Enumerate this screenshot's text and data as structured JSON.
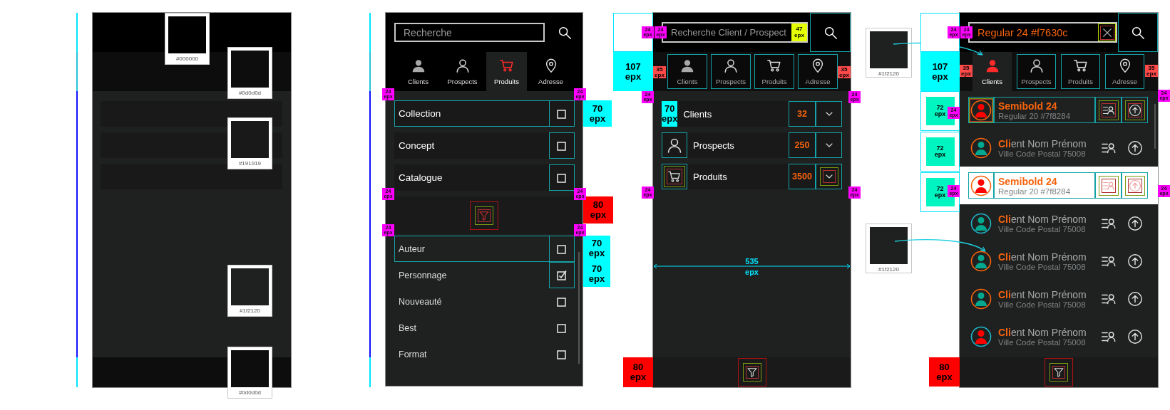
{
  "palette_panel": {
    "swatches": [
      {
        "label": "#000000",
        "color": "#000000"
      },
      {
        "label": "#0d0d0d",
        "color": "#0d0d0d"
      },
      {
        "label": "#191919",
        "color": "#191919"
      },
      {
        "label": "#1f2120",
        "color": "#1f2120"
      },
      {
        "label": "#0d0d0d",
        "color": "#0d0d0d"
      }
    ]
  },
  "filter_panel": {
    "search": {
      "placeholder": "Recherche"
    },
    "tabs": [
      {
        "label": "Clients",
        "selected": false
      },
      {
        "label": "Prospects",
        "selected": false
      },
      {
        "label": "Produits",
        "selected": true
      },
      {
        "label": "Adresse",
        "selected": false
      }
    ],
    "categories": [
      {
        "label": "Collection",
        "checked": false
      },
      {
        "label": "Concept",
        "checked": false
      },
      {
        "label": "Catalogue",
        "checked": false
      }
    ],
    "options": [
      {
        "label": "Auteur",
        "checked": false
      },
      {
        "label": "Personnage",
        "checked": true
      },
      {
        "label": "Nouveauté",
        "checked": false
      },
      {
        "label": "Best",
        "checked": false
      },
      {
        "label": "Format",
        "checked": false
      }
    ]
  },
  "summary_panel": {
    "search": {
      "placeholder": "Recherche Client / Prospect"
    },
    "tabs": [
      {
        "label": "Clients",
        "selected": false
      },
      {
        "label": "Prospects",
        "selected": false
      },
      {
        "label": "Produits",
        "selected": false
      },
      {
        "label": "Adresse",
        "selected": false
      }
    ],
    "rows": [
      {
        "label": "Clients",
        "count": "32",
        "icon_note": "70 epx"
      },
      {
        "label": "Prospects",
        "count": "250"
      },
      {
        "label": "Produits",
        "count": "3500"
      }
    ],
    "width_note": "535 epx"
  },
  "list_panel": {
    "search": {
      "value": "Regular 24 #f7630c"
    },
    "tabs": [
      {
        "label": "Clients",
        "selected": true
      },
      {
        "label": "Prospects",
        "selected": false
      },
      {
        "label": "Produits",
        "selected": false
      },
      {
        "label": "Adresse",
        "selected": false
      }
    ],
    "rows": [
      {
        "kind": "spec",
        "name": "Semibold 24",
        "subtitle": "Regular 20 #7f8284",
        "avatar": {
          "color": "#ff0000"
        },
        "ring": {
          "color": "#f7630c"
        },
        "selected": false
      },
      {
        "kind": "client",
        "name": "**Cli**ent Nom Prénom",
        "subtitle": "Ville Code Postal 75008",
        "avatar": {
          "color": "#00a88f"
        },
        "ring": {
          "color": "#f7630c"
        },
        "selected": false
      },
      {
        "kind": "spec",
        "name": "Semibold 24",
        "subtitle": "Regular 20 #7f8284",
        "avatar": {
          "color": "#ff0000"
        },
        "ring": {
          "color": "#f7630c"
        },
        "selected": true
      },
      {
        "kind": "client",
        "name": "**Cli**ent Nom Prénom",
        "subtitle": "Ville Code Postal 75008",
        "avatar": {
          "color": "#00a88f"
        },
        "ring": {
          "color": "#1fb5c9"
        },
        "selected": false
      },
      {
        "kind": "client",
        "name": "**Cli**ent Nom Prénom",
        "subtitle": "Ville Code Postal 75008",
        "avatar": {
          "color": "#00a88f"
        },
        "ring": {
          "color": "#f7630c"
        },
        "selected": false
      },
      {
        "kind": "client",
        "name": "**Cli**ent Nom Prénom",
        "subtitle": "Ville Code Postal 75008",
        "avatar": {
          "color": "#00a88f"
        },
        "ring": {
          "color": "#f7630c"
        },
        "selected": false
      },
      {
        "kind": "client",
        "name": "**Cli**ent Nom Prénom",
        "subtitle": "Ville Code Postal 75008",
        "avatar": {
          "color": "#ff0000"
        },
        "ring": {
          "color": "#1fb5c9"
        },
        "selected": false
      }
    ]
  },
  "callouts": [
    {
      "label": "#1f2120",
      "color": "#1f2120"
    },
    {
      "label": "#1f2120",
      "color": "#1f2120"
    }
  ],
  "annotations": [
    {
      "text": "70 epx",
      "kind": "cyan"
    },
    {
      "text": "80 epx",
      "kind": "red"
    },
    {
      "text": "70 epx",
      "kind": "cyan"
    },
    {
      "text": "70 epx",
      "kind": "cyan"
    },
    {
      "text": "107 epx",
      "kind": "cyan"
    },
    {
      "text": "47 epx",
      "kind": "yellow"
    },
    {
      "text": "35 epx",
      "kind": "small-red"
    },
    {
      "text": "35 epx",
      "kind": "small-red"
    },
    {
      "text": "80 epx",
      "kind": "red"
    },
    {
      "text": "107 epx",
      "kind": "cyan"
    },
    {
      "text": "72 epx",
      "kind": "green"
    },
    {
      "text": "72 epx",
      "kind": "green"
    },
    {
      "text": "72 epx",
      "kind": "green"
    },
    {
      "text": "35 epx",
      "kind": "small-red"
    },
    {
      "text": "35 epx",
      "kind": "small-red"
    },
    {
      "text": "80 epx",
      "kind": "red"
    },
    {
      "text": "24 epx",
      "kind": "magenta"
    },
    {
      "text": "24 epx",
      "kind": "magenta"
    },
    {
      "text": "24 epx",
      "kind": "magenta"
    },
    {
      "text": "24 epx",
      "kind": "magenta"
    },
    {
      "text": "24 epx",
      "kind": "magenta"
    },
    {
      "text": "24 epx",
      "kind": "magenta"
    },
    {
      "text": "24 epx",
      "kind": "magenta"
    },
    {
      "text": "24 epx",
      "kind": "magenta"
    },
    {
      "text": "24 epx",
      "kind": "magenta"
    },
    {
      "text": "24 epx",
      "kind": "magenta"
    },
    {
      "text": "24 epx",
      "kind": "magenta"
    },
    {
      "text": "24 epx",
      "kind": "magenta"
    },
    {
      "text": "24 epx",
      "kind": "magenta"
    },
    {
      "text": "24 epx",
      "kind": "magenta"
    },
    {
      "text": "24 epx",
      "kind": "magenta"
    },
    {
      "text": "24 epx",
      "kind": "magenta"
    },
    {
      "text": "24 epx",
      "kind": "magenta"
    },
    {
      "text": "24 epx",
      "kind": "magenta"
    }
  ]
}
